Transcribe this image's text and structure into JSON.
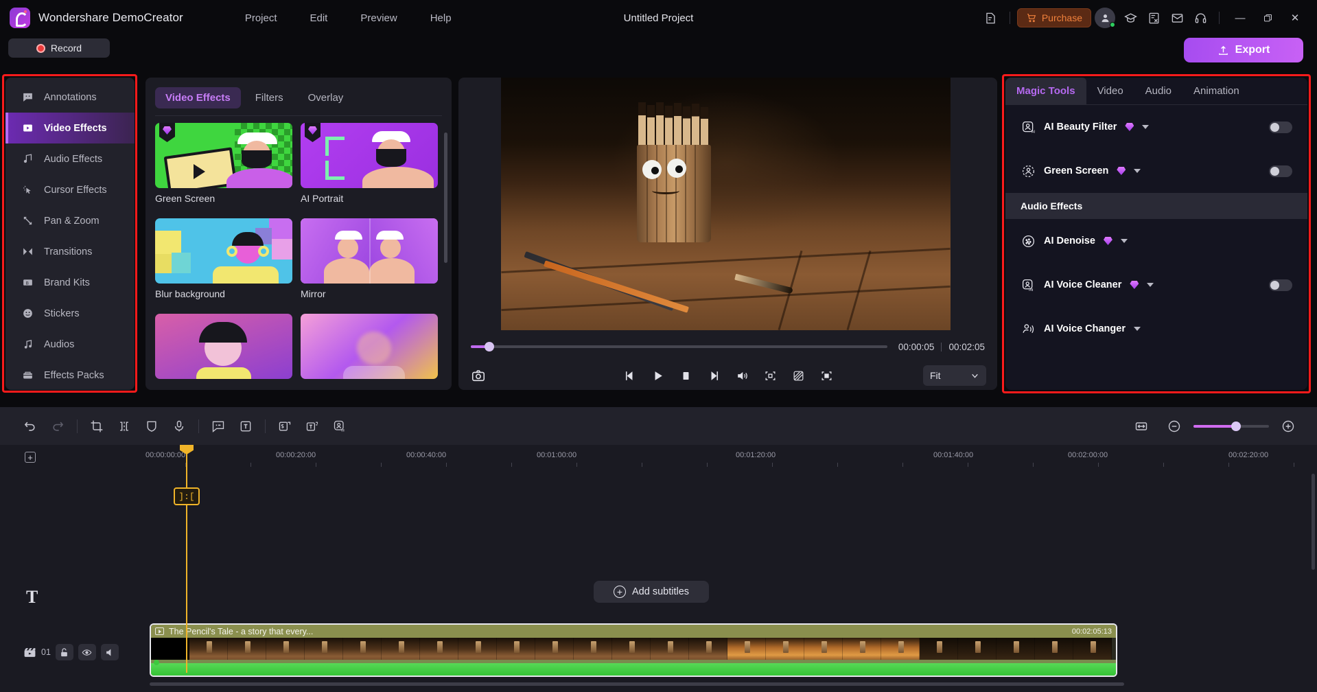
{
  "titlebar": {
    "app_name": "Wondershare DemoCreator",
    "menus": [
      "Project",
      "Edit",
      "Preview",
      "Help"
    ],
    "project_title": "Untitled Project",
    "purchase_label": "Purchase",
    "icons": [
      "note-edit-icon",
      "cart-icon",
      "account-icon",
      "graduation-cap-icon",
      "script-icon",
      "mail-icon",
      "headset-icon"
    ],
    "window_minimize": "—",
    "window_maximize": "❐",
    "window_close": "✕"
  },
  "actions": {
    "record_label": "Record",
    "export_label": "Export"
  },
  "sidebar": {
    "items": [
      {
        "label": "Annotations",
        "icon": "annotation-icon",
        "active": false
      },
      {
        "label": "Video Effects",
        "icon": "video-effects-icon",
        "active": true
      },
      {
        "label": "Audio Effects",
        "icon": "audio-effects-icon",
        "active": false
      },
      {
        "label": "Cursor Effects",
        "icon": "cursor-effects-icon",
        "active": false
      },
      {
        "label": "Pan & Zoom",
        "icon": "pan-zoom-icon",
        "active": false
      },
      {
        "label": "Transitions",
        "icon": "transitions-icon",
        "active": false
      },
      {
        "label": "Brand Kits",
        "icon": "brand-kits-icon",
        "active": false
      },
      {
        "label": "Stickers",
        "icon": "stickers-icon",
        "active": false
      },
      {
        "label": "Audios",
        "icon": "audios-icon",
        "active": false
      },
      {
        "label": "Effects Packs",
        "icon": "effects-packs-icon",
        "active": false
      }
    ]
  },
  "gallery": {
    "tabs": [
      {
        "label": "Video Effects",
        "active": true
      },
      {
        "label": "Filters",
        "active": false
      },
      {
        "label": "Overlay",
        "active": false
      }
    ],
    "effects": [
      {
        "label": "Green Screen",
        "premium": true
      },
      {
        "label": "AI Portrait",
        "premium": true
      },
      {
        "label": "Blur background",
        "premium": false
      },
      {
        "label": "Mirror",
        "premium": false
      },
      {
        "label": "",
        "premium": false
      },
      {
        "label": "",
        "premium": false
      }
    ]
  },
  "preview": {
    "current_time": "00:00:05",
    "total_time": "00:02:05",
    "fit_label": "Fit",
    "controls": [
      "snapshot-icon",
      "prev-frame-icon",
      "play-icon",
      "stop-icon",
      "next-frame-icon",
      "volume-icon",
      "crop-frame-icon",
      "no-effect-icon",
      "fullscreen-icon"
    ]
  },
  "right_panel": {
    "tabs": [
      {
        "label": "Magic Tools",
        "active": true
      },
      {
        "label": "Video",
        "active": false
      },
      {
        "label": "Audio",
        "active": false
      },
      {
        "label": "Animation",
        "active": false
      }
    ],
    "video_rows": [
      {
        "label": "AI Beauty Filter",
        "premium": true,
        "has_toggle": true,
        "toggle_on": false,
        "icon": "ai-person-icon"
      },
      {
        "label": "Green Screen",
        "premium": true,
        "has_toggle": true,
        "toggle_on": false,
        "icon": "dashed-person-icon"
      }
    ],
    "audio_section_label": "Audio Effects",
    "audio_rows": [
      {
        "label": "AI Denoise",
        "premium": true,
        "has_toggle": false,
        "toggle_on": false,
        "icon": "denoise-icon"
      },
      {
        "label": "AI Voice Cleaner",
        "premium": true,
        "has_toggle": true,
        "toggle_on": false,
        "icon": "voice-cleaner-icon"
      },
      {
        "label": "AI Voice Changer",
        "premium": false,
        "has_toggle": false,
        "toggle_on": false,
        "icon": "voice-changer-icon"
      }
    ]
  },
  "timeline": {
    "tools": [
      "undo-icon",
      "redo-icon",
      "crop-icon",
      "split-icon",
      "mask-icon",
      "microphone-icon",
      "caption-icon",
      "text-icon",
      "subtitle-template-icon",
      "text-template-icon",
      "avatar-icon"
    ],
    "zoom_tools": [
      "fit-timeline-icon",
      "zoom-out-icon",
      "zoom-slider",
      "zoom-in-icon"
    ],
    "ruler_ticks": [
      "00:00:00:00",
      "00:00:20:00",
      "00:00:40:00",
      "00:01:00:00",
      "00:01:20:00",
      "00:01:40:00",
      "00:02:00:00",
      "00:02:20:00"
    ],
    "playhead_marker": "]:[",
    "add_subtitles_label": "Add subtitles",
    "track_number": "01",
    "track_buttons": [
      "unlock-icon",
      "eye-icon",
      "mute-icon"
    ],
    "clip": {
      "title": "The Pencil's Tale - a story that every...",
      "duration": "00:02:05:13"
    }
  },
  "colors": {
    "accent_purple": "#b569f0",
    "highlight_red": "#fc1b1b",
    "playhead_yellow": "#f0b429",
    "purchase_orange": "#f0813c"
  }
}
